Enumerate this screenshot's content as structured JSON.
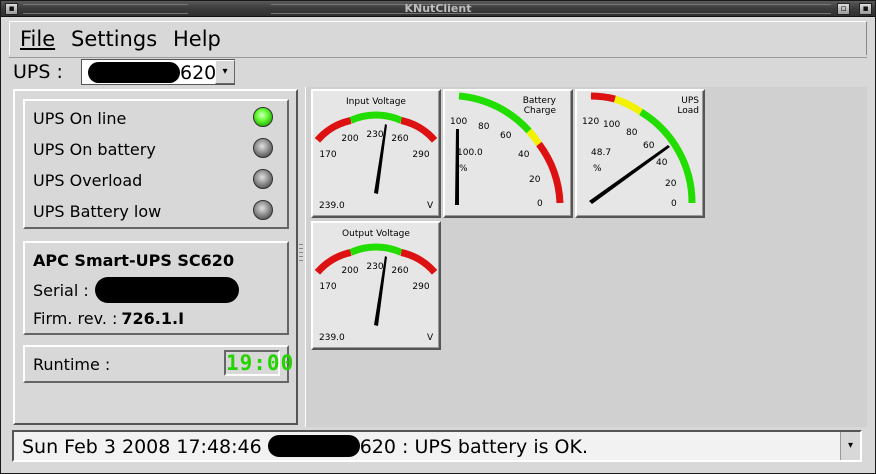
{
  "window": {
    "title": "KNutClient"
  },
  "menu": {
    "file_label": "File",
    "settings_label": "Settings",
    "help_label": "Help"
  },
  "ups_selector": {
    "label": "UPS :",
    "value_suffix": "620"
  },
  "status_indicators": [
    {
      "label": "UPS On line",
      "state": "on"
    },
    {
      "label": "UPS On battery",
      "state": "off"
    },
    {
      "label": "UPS Overload",
      "state": "off"
    },
    {
      "label": "UPS Battery low",
      "state": "off"
    }
  ],
  "info": {
    "model": "APC Smart-UPS SC620",
    "serial_label": "Serial :",
    "firm_label": "Firm. rev. :",
    "firm_value": "726.1.I"
  },
  "runtime": {
    "label": "Runtime :",
    "value": "19:00"
  },
  "gauges": {
    "input_voltage": {
      "title": "Input Voltage",
      "ticks": [
        "170",
        "200",
        "230",
        "260",
        "290"
      ],
      "value_text": "239.0",
      "unit": "V",
      "value": 239.0
    },
    "battery_charge": {
      "title_line1": "Battery",
      "title_line2": "Charge",
      "ticks": [
        "100",
        "80",
        "60",
        "40",
        "20",
        "0"
      ],
      "value_text": "100.0",
      "unit": "%",
      "value": 100.0
    },
    "ups_load": {
      "title_line1": "UPS",
      "title_line2": "Load",
      "ticks": [
        "120",
        "100",
        "80",
        "60",
        "40",
        "20",
        "0"
      ],
      "value_text": "48.7",
      "unit": "%",
      "value": 48.7
    },
    "output_voltage": {
      "title": "Output Voltage",
      "ticks": [
        "170",
        "200",
        "230",
        "260",
        "290"
      ],
      "value_text": "239.0",
      "unit": "V",
      "value": 239.0
    }
  },
  "statusbar": {
    "prefix": "Sun Feb 3 2008 17:48:46",
    "suffix": "620 : UPS battery is OK."
  },
  "colors": {
    "led_on": "#6cff3c",
    "runtime_digits": "#25d300",
    "gauge_red": "#dd1111",
    "gauge_green": "#22dd00",
    "gauge_yellow": "#f2f200"
  }
}
